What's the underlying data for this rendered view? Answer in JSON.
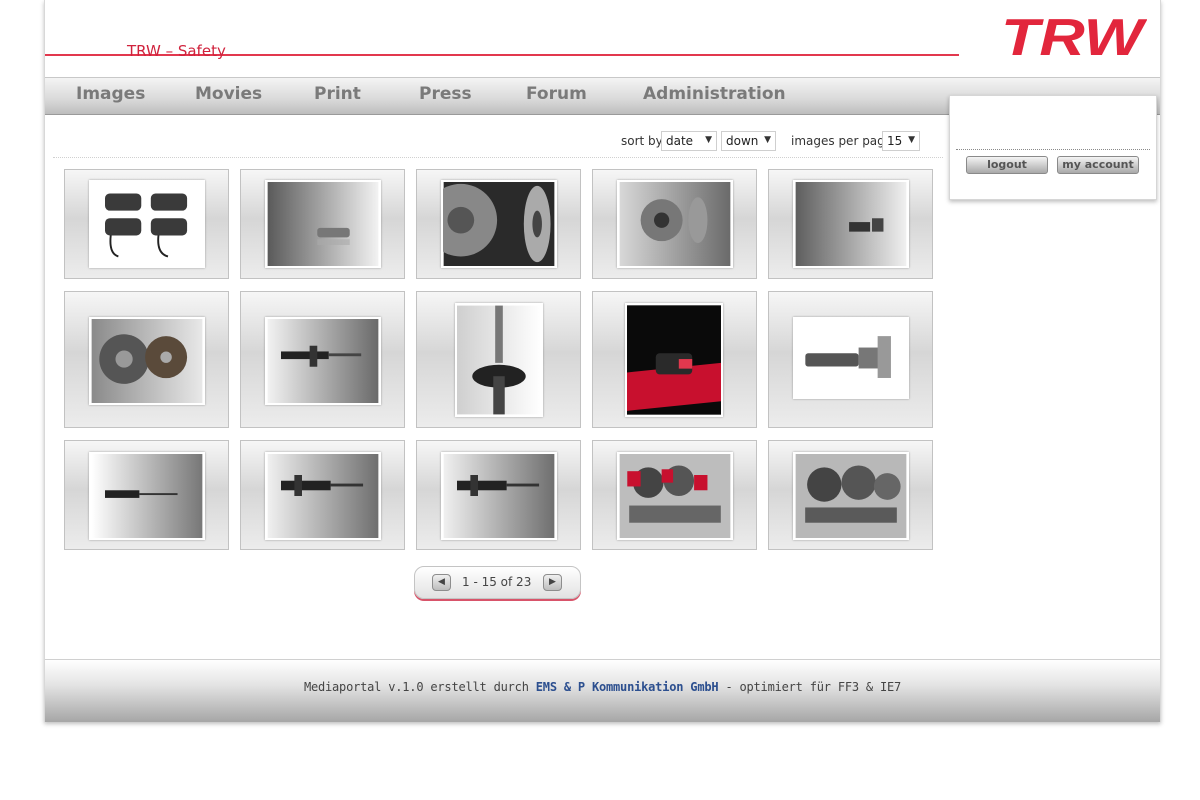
{
  "header": {
    "subtitle": "TRW – Safety",
    "logo_text": "TRW",
    "brand_color": "#e2384e"
  },
  "nav": {
    "items": [
      {
        "label": "Images"
      },
      {
        "label": "Movies"
      },
      {
        "label": "Print"
      },
      {
        "label": "Press"
      },
      {
        "label": "Forum"
      },
      {
        "label": "Administration"
      }
    ]
  },
  "sortbar": {
    "sort_by_label": "sort by",
    "sort_value": "date",
    "order_value": "down",
    "per_page_label": "images per page",
    "per_page_value": "15"
  },
  "gallery": {
    "images": [
      {
        "icon": "brake-pads-image"
      },
      {
        "icon": "brake-pad-image"
      },
      {
        "icon": "brake-disc-closeup-image"
      },
      {
        "icon": "brake-disc-image"
      },
      {
        "icon": "brake-caliper-image"
      },
      {
        "icon": "clutch-kit-image"
      },
      {
        "icon": "shock-absorber-image"
      },
      {
        "icon": "strut-mount-image"
      },
      {
        "icon": "red-brake-pad-image"
      },
      {
        "icon": "master-cylinder-image"
      },
      {
        "icon": "shock-absorber-image"
      },
      {
        "icon": "strut-image"
      },
      {
        "icon": "strut-image"
      },
      {
        "icon": "brake-parts-red-image"
      },
      {
        "icon": "brake-parts-set-image"
      }
    ]
  },
  "pager": {
    "text": "1 - 15 of 23",
    "prev_icon": "arrow-left-icon",
    "next_icon": "arrow-right-icon"
  },
  "user": {
    "logout_label": "logout",
    "account_label": "my account"
  },
  "footer": {
    "prefix": "Mediaportal v.1.0 erstellt durch",
    "company": "EMS & P Kommunikation GmbH",
    "suffix": "- optimiert für FF3 & IE7"
  }
}
